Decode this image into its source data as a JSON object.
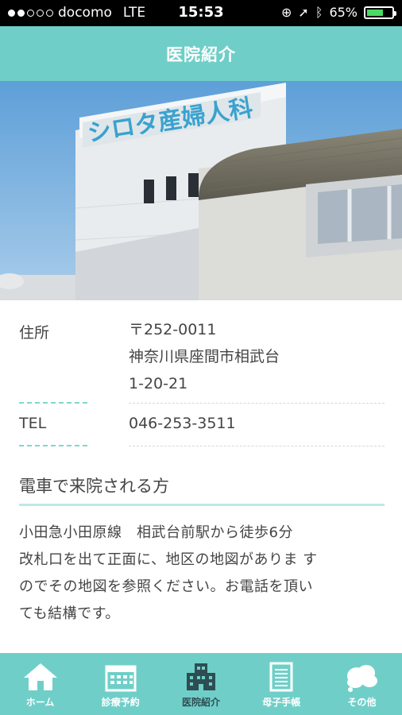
{
  "status_bar": {
    "carrier": "docomo",
    "network": "LTE",
    "time": "15:53",
    "battery": "65%",
    "battery_level": 0.65
  },
  "header": {
    "title": "医院紹介"
  },
  "hero": {
    "sign_text": "シロタ産婦人科"
  },
  "info": {
    "address_label": "住所",
    "address_lines": [
      "〒252-0011",
      "神奈川県座間市相武台",
      "1-20-21"
    ],
    "tel_label": "TEL",
    "tel_value": "046-253-3511"
  },
  "access": {
    "title": "電車で来院される方",
    "lines": [
      "小田急小田原線　相武台前駅から徒歩6分",
      "改札口を出て正面に、地区の地図がありま す",
      "のでその地図を参照ください。お電話を頂い",
      "ても結構です。"
    ]
  },
  "tabs": [
    {
      "label": "ホーム",
      "icon": "home-icon",
      "active": false
    },
    {
      "label": "診療予約",
      "icon": "calendar-icon",
      "active": false
    },
    {
      "label": "医院紹介",
      "icon": "hospital-icon",
      "active": true
    },
    {
      "label": "母子手帳",
      "icon": "notebook-icon",
      "active": false
    },
    {
      "label": "その他",
      "icon": "more-cloud-icon",
      "active": false
    }
  ],
  "colors": {
    "accent": "#6fcfc8",
    "active_tab_text": "#2e4d52"
  }
}
